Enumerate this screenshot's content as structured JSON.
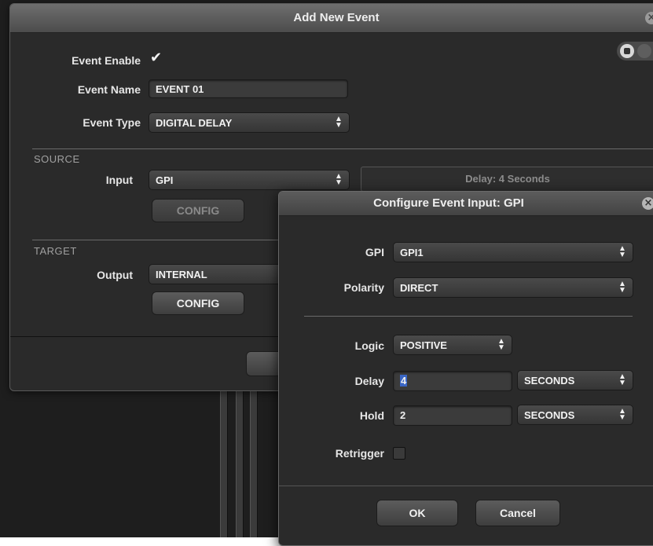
{
  "main_dialog": {
    "title": "Add New Event",
    "event_enable_label": "Event Enable",
    "event_enable_checked": true,
    "event_name_label": "Event Name",
    "event_name_value": "EVENT 01",
    "event_type_label": "Event Type",
    "event_type_value": "DIGITAL DELAY",
    "source_section": "SOURCE",
    "input_label": "Input",
    "input_value": "GPI",
    "config_label": "CONFIG",
    "delay_info": "Delay: 4 Seconds",
    "target_section": "TARGET",
    "output_label": "Output",
    "output_value": "INTERNAL",
    "target_config_label": "CONFIG"
  },
  "sub_dialog": {
    "title": "Configure Event Input: GPI",
    "gpi_label": "GPI",
    "gpi_value": "GPI1",
    "polarity_label": "Polarity",
    "polarity_value": "DIRECT",
    "logic_label": "Logic",
    "logic_value": "POSITIVE",
    "delay_label": "Delay",
    "delay_value": "4",
    "delay_unit": "SECONDS",
    "hold_label": "Hold",
    "hold_value": "2",
    "hold_unit": "SECONDS",
    "retrigger_label": "Retrigger",
    "retrigger_checked": false,
    "ok_label": "OK",
    "cancel_label": "Cancel"
  },
  "icons": {
    "close": "×",
    "checkmark": "✔",
    "select_arrows": "⬍"
  }
}
